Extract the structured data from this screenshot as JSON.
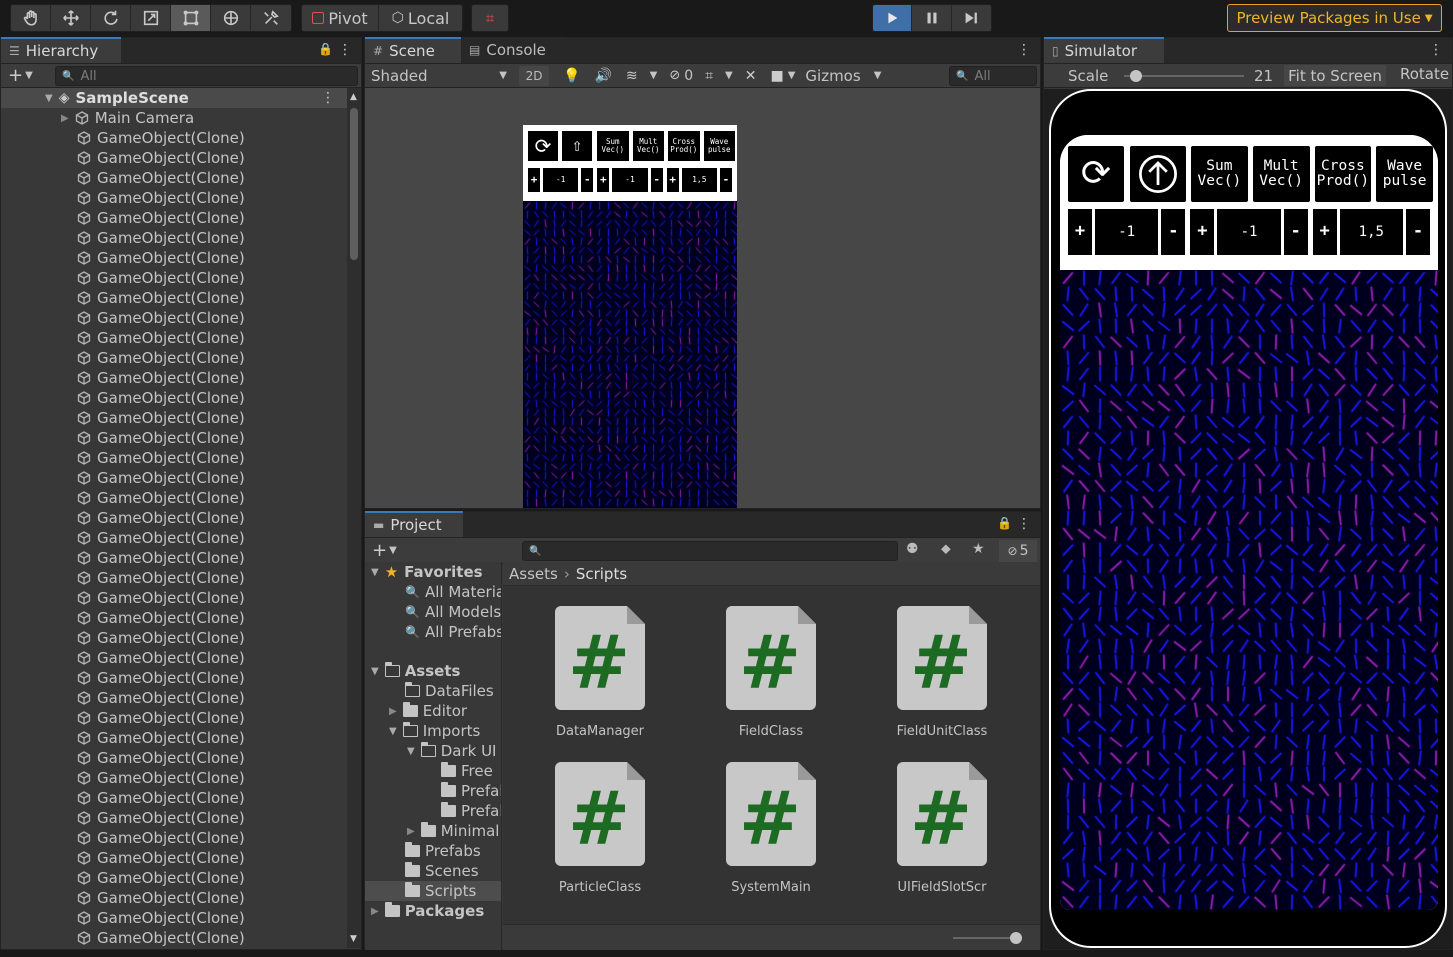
{
  "toolbar": {
    "tools": [
      "hand-tool",
      "move-tool",
      "rotate-tool",
      "scale-tool",
      "rect-tool",
      "transform-tool",
      "custom-tool"
    ],
    "pivot_label": "Pivot",
    "local_label": "Local",
    "preview_packages": "Preview Packages in Use"
  },
  "hierarchy": {
    "tab_label": "Hierarchy",
    "search_placeholder": "All",
    "scene_name": "SampleScene",
    "main_camera": "Main Camera",
    "clone_label": "GameObject(Clone)",
    "clone_count": 41
  },
  "scene": {
    "tab_scene": "Scene",
    "tab_console": "Console",
    "shading_mode": "Shaded",
    "mode_2d": "2D",
    "hidden_count": "0",
    "gizmos_label": "Gizmos",
    "search_placeholder": "All"
  },
  "simulator": {
    "tab_label": "Simulator",
    "scale_label": "Scale",
    "scale_value": "21",
    "scale_level": 0.1,
    "fit_label": "Fit to Screen",
    "rotate_label": "Rotate"
  },
  "game_ui": {
    "buttons": [
      {
        "line1": "Sum",
        "line2": "Vec()"
      },
      {
        "line1": "Mult",
        "line2": "Vec()"
      },
      {
        "line1": "Cross",
        "line2": "Prod()"
      },
      {
        "line1": "Wave",
        "line2": "pulse"
      }
    ],
    "steppers": [
      {
        "plus": "+",
        "value": "-1",
        "minus": "-"
      },
      {
        "plus": "+",
        "value": "-1",
        "minus": "-"
      },
      {
        "plus": "+",
        "value": "1,5",
        "minus": "-"
      }
    ],
    "field_colors": {
      "background": "#00001e",
      "primary": "#1a1aff",
      "secondary": "#a020c0"
    }
  },
  "project": {
    "tab_label": "Project",
    "hidden_packages_count": "5",
    "favorites_label": "Favorites",
    "favorites": [
      "All Materia",
      "All Models",
      "All Prefabs"
    ],
    "assets_label": "Assets",
    "tree": {
      "datafiles": "DataFiles",
      "editor": "Editor",
      "imports": "Imports",
      "dark_ui": "Dark UI",
      "free": "Free",
      "prefab1": "Prefal",
      "prefab2": "Prefal",
      "minimal": "Minimal",
      "prefabs": "Prefabs",
      "scenes": "Scenes",
      "scripts": "Scripts"
    },
    "packages_label": "Packages",
    "breadcrumb": [
      "Assets",
      "Scripts"
    ],
    "files": [
      "DataManager",
      "FieldClass",
      "FieldUnitClass",
      "ParticleClass",
      "SystemMain",
      "UIFieldSlotScr"
    ],
    "zoom_level": 0.95
  }
}
